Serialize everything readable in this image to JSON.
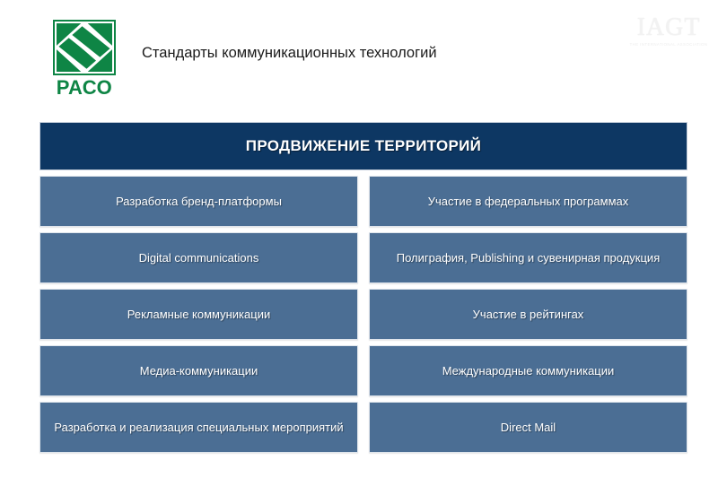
{
  "header": {
    "title": "Стандарты коммуникационных технологий",
    "logo": {
      "wordmark": "РАСО",
      "icon_name": "raco-pinwheel-logo"
    },
    "partner_logo": {
      "wordmark": "IAGT",
      "tagline": "THE INTERNATIONAL ASSOCIATION",
      "icon_name": "iagt-watermark-logo"
    }
  },
  "banner": {
    "label": "ПРОДВИЖЕНИЕ ТЕРРИТОРИЙ",
    "background_color": "#0d3763",
    "text_color": "#ffffff"
  },
  "grid": {
    "box_color": "#4b6e94",
    "box_text_color": "#ffffff",
    "columns": 2,
    "rows": 5,
    "items": [
      {
        "id": "brand-platform",
        "label": "Разработка бренд-платформы",
        "column": "left",
        "row": 1
      },
      {
        "id": "federal-programs",
        "label": "Участие в федеральных программах",
        "column": "right",
        "row": 1
      },
      {
        "id": "digital-communications",
        "label": "Digital communications",
        "column": "left",
        "row": 2
      },
      {
        "id": "printing-publishing",
        "label": "Полиграфия, Publishing и сувенирная продукция",
        "column": "right",
        "row": 2
      },
      {
        "id": "advertising",
        "label": "Рекламные коммуникации",
        "column": "left",
        "row": 3
      },
      {
        "id": "ratings",
        "label": "Участие в рейтингах",
        "column": "right",
        "row": 3
      },
      {
        "id": "media-communications",
        "label": "Медиа-коммуникации",
        "column": "left",
        "row": 4
      },
      {
        "id": "international",
        "label": "Международные коммуникации",
        "column": "right",
        "row": 4
      },
      {
        "id": "special-events",
        "label": "Разработка и реализация специальных мероприятий",
        "column": "left",
        "row": 5
      },
      {
        "id": "direct-mail",
        "label": "Direct Mail",
        "column": "right",
        "row": 5
      }
    ]
  }
}
